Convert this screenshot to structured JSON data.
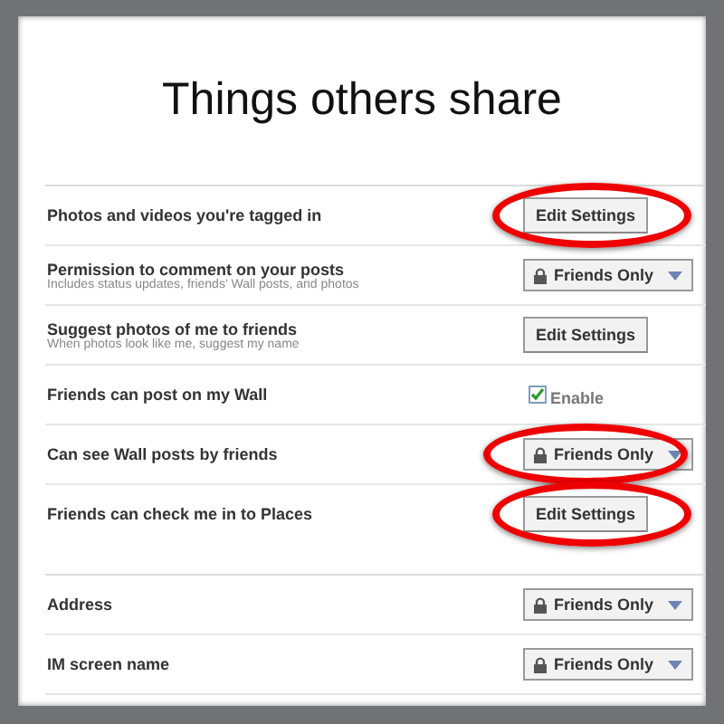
{
  "title": "Things others share",
  "sections": [
    {
      "rows": [
        {
          "label": "Photos and videos you're tagged in",
          "control": {
            "kind": "button",
            "text": "Edit Settings"
          },
          "highlighted": true
        },
        {
          "label": "Permission to comment on your posts",
          "description": "Includes status updates, friends' Wall posts, and photos",
          "control": {
            "kind": "dropdown",
            "text": "Friends Only"
          },
          "highlighted": false
        },
        {
          "label": "Suggest photos of me to friends",
          "description": "When photos look like me, suggest my name",
          "control": {
            "kind": "button",
            "text": "Edit Settings"
          },
          "highlighted": false
        },
        {
          "label": "Friends can post on my Wall",
          "control": {
            "kind": "checkbox",
            "text": "Enable",
            "checked": true
          },
          "highlighted": false
        },
        {
          "label": "Can see Wall posts by friends",
          "control": {
            "kind": "dropdown",
            "text": "Friends Only"
          },
          "highlighted": true
        },
        {
          "label": "Friends can check me in to Places",
          "control": {
            "kind": "button",
            "text": "Edit Settings"
          },
          "highlighted": true
        }
      ]
    },
    {
      "rows": [
        {
          "label": "Address",
          "control": {
            "kind": "dropdown",
            "text": "Friends Only"
          },
          "highlighted": false
        },
        {
          "label": "IM screen name",
          "control": {
            "kind": "dropdown",
            "text": "Friends Only"
          },
          "highlighted": false
        }
      ]
    }
  ]
}
